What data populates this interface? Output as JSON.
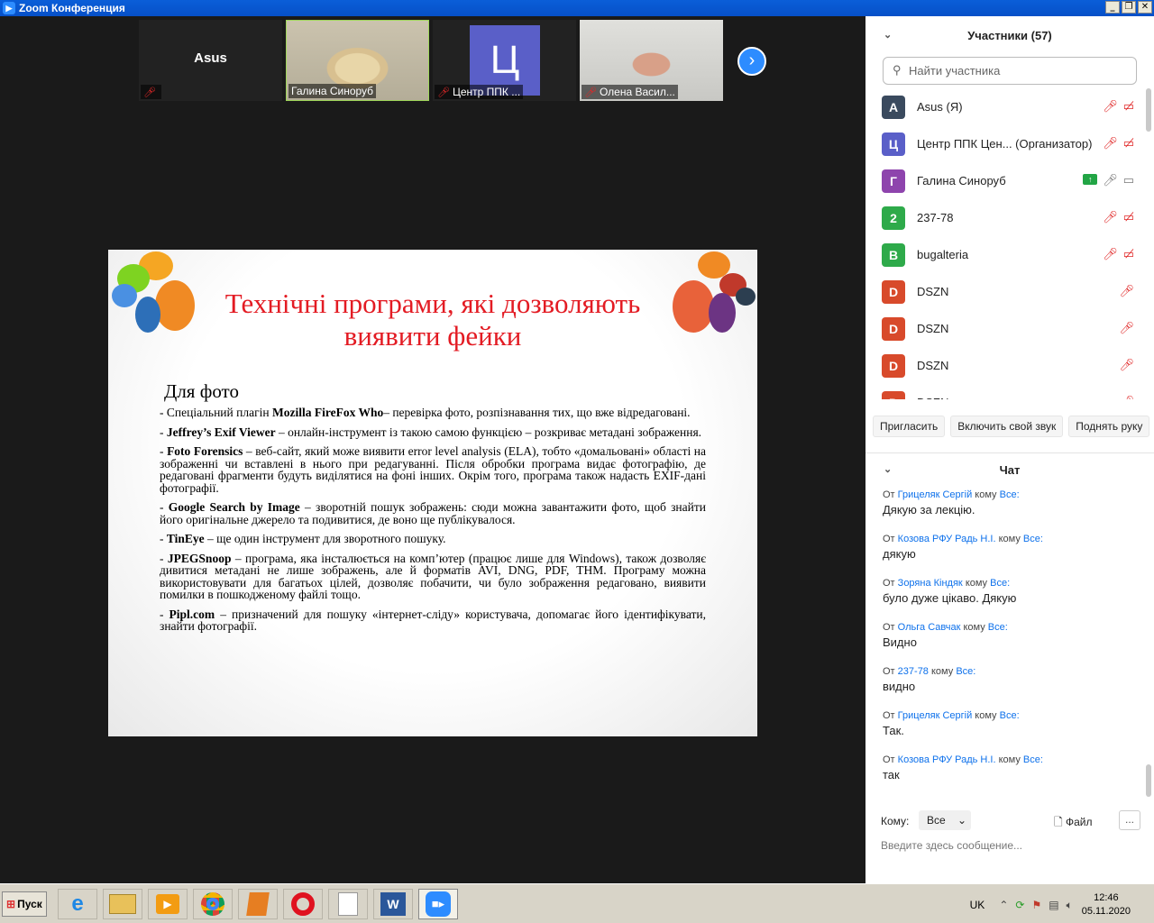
{
  "window": {
    "title": "Zoom Конференция"
  },
  "thumbnails": [
    {
      "name": "Asus",
      "label": ""
    },
    {
      "name": "",
      "label": "Галина Синоруб"
    },
    {
      "name": "",
      "label": "Центр ППК ...",
      "avatar": "Ц"
    },
    {
      "name": "",
      "label": "Олена Васил..."
    }
  ],
  "slide": {
    "title": "Технічні програми, які дозволяють виявити фейки",
    "subtitle": "Для фото",
    "items": [
      {
        "prefix": "- Спеціальний плагін ",
        "bold": "Mozilla FireFox Who",
        "text": "– перевірка фото, розпізнавання тих, що вже відредаговані."
      },
      {
        "prefix": "- ",
        "bold": "Jeffrey’s Exif Viewer",
        "text": " – онлайн-інструмент із такою самою функцією – розкриває метадані зображення."
      },
      {
        "prefix": "- ",
        "bold": "Foto Forensics",
        "text": " – веб-сайт, який може виявити error level analysis (ELA), тобто «домальовані» області на зображенні чи вставлені в нього при редагуванні. Після обробки програма видає фотографію, де редаговані фрагменти будуть виділятися на фоні інших. Окрім того, програма також надасть EXIF-дані фотографії."
      },
      {
        "prefix": "- ",
        "bold": "Google Search by Image",
        "text": " – зворотній пошук зображень: сюди можна завантажити фото, щоб знайти його оригінальне джерело та подивитися, де воно ще публікувалося."
      },
      {
        "prefix": "- ",
        "bold": "TinEye",
        "text": " – ще один інструмент для зворотного пошуку."
      },
      {
        "prefix": "- ",
        "bold": "JPEGSnoop",
        "text": " – програма, яка інсталюється на комп’ютер (працює лише для Windows), також дозволяє дивитися метадані не лише зображень, але й  форматів AVI, DNG, PDF, THM. Програму можна використовувати для багатьох цілей, дозволяє побачити, чи було зображення редаговано, виявити помилки в пошкодженому файлі тощо."
      },
      {
        "prefix": "- ",
        "bold": "Pipl.com",
        "text": " – призначений для пошуку «інтернет-сліду» користувача, допомагає його ідентифікувати, знайти фотографії."
      }
    ]
  },
  "participants": {
    "header": "Участники (57)",
    "search_placeholder": "Найти участника",
    "list": [
      {
        "avatar": "A",
        "color": "#3a4a5e",
        "name": "Asus (Я)",
        "icons": [
          "mic-off",
          "video-off"
        ]
      },
      {
        "avatar": "Ц",
        "color": "#5a5fc8",
        "name": "Центр ППК Цен... (Организатор)",
        "icons": [
          "mic-off",
          "video-off"
        ]
      },
      {
        "avatar": "Г",
        "color": "#8e44ad",
        "name": "Галина Синоруб",
        "icons": [
          "share",
          "mic",
          "video"
        ]
      },
      {
        "avatar": "2",
        "color": "#2eaa4a",
        "name": "237-78",
        "icons": [
          "mic-off",
          "video-off"
        ]
      },
      {
        "avatar": "B",
        "color": "#2eaa4a",
        "name": "bugalteria",
        "icons": [
          "mic-off",
          "video-off"
        ]
      },
      {
        "avatar": "D",
        "color": "#d84a2b",
        "name": "DSZN",
        "icons": [
          "mic-off"
        ]
      },
      {
        "avatar": "D",
        "color": "#d84a2b",
        "name": "DSZN",
        "icons": [
          "mic-off"
        ]
      },
      {
        "avatar": "D",
        "color": "#d84a2b",
        "name": "DSZN",
        "icons": [
          "mic-off"
        ]
      },
      {
        "avatar": "D",
        "color": "#d84a2b",
        "name": "DSZN",
        "icons": [
          "mic-off"
        ]
      }
    ],
    "buttons": {
      "invite": "Пригласить",
      "unmute": "Включить свой звук",
      "raise_hand": "Поднять руку"
    }
  },
  "chat": {
    "header": "Чат",
    "from_label": "От",
    "to_label": "кому",
    "messages": [
      {
        "from": "Грицеляк Сергій",
        "to": "Все:",
        "text": "Дякую за лекцію."
      },
      {
        "from": "Козова РФУ Радь Н.І.",
        "to": "Все:",
        "text": "дякую"
      },
      {
        "from": "Зоряна Кіндяк",
        "to": "Все:",
        "text": "було дуже цікаво. Дякую"
      },
      {
        "from": "Ольга Савчак",
        "to": "Все:",
        "text": "Видно"
      },
      {
        "from": "237-78",
        "to": "Все:",
        "text": "видно"
      },
      {
        "from": "Грицеляк Сергій",
        "to": "Все:",
        "text": "Так."
      },
      {
        "from": "Козова РФУ Радь Н.І.",
        "to": "Все:",
        "text": "так"
      }
    ],
    "to_prompt": "Кому:",
    "to_value": "Все",
    "file_label": "Файл",
    "more_label": "...",
    "input_placeholder": "Введите здесь сообщение..."
  },
  "taskbar": {
    "start_label": "Пуск",
    "language": "UK",
    "time": "12:46",
    "date": "05.11.2020"
  }
}
